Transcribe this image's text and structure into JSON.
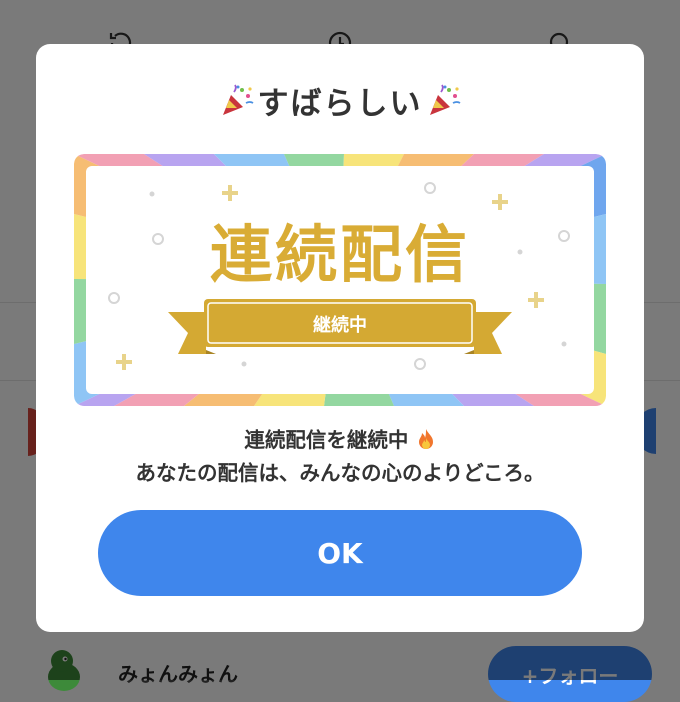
{
  "background": {
    "list_item": {
      "username": "みょんみょん",
      "follow_label": "+フォロー"
    }
  },
  "dialog": {
    "title": "すばらしい",
    "badge": {
      "heading": "連続配信",
      "ribbon_label": "継続中"
    },
    "message_line1": "連続配信を継続中",
    "message_line2": "あなたの配信は、みんなの心のよりどころ。",
    "ok_label": "OK"
  },
  "colors": {
    "accent_blue": "#3f86ec",
    "badge_gold": "#d9ac35",
    "ribbon_gold": "#d4a933"
  },
  "icons": [
    "party-popper-icon",
    "flame-icon",
    "history-icon",
    "clock-icon",
    "search-icon",
    "dinosaur-avatar"
  ]
}
